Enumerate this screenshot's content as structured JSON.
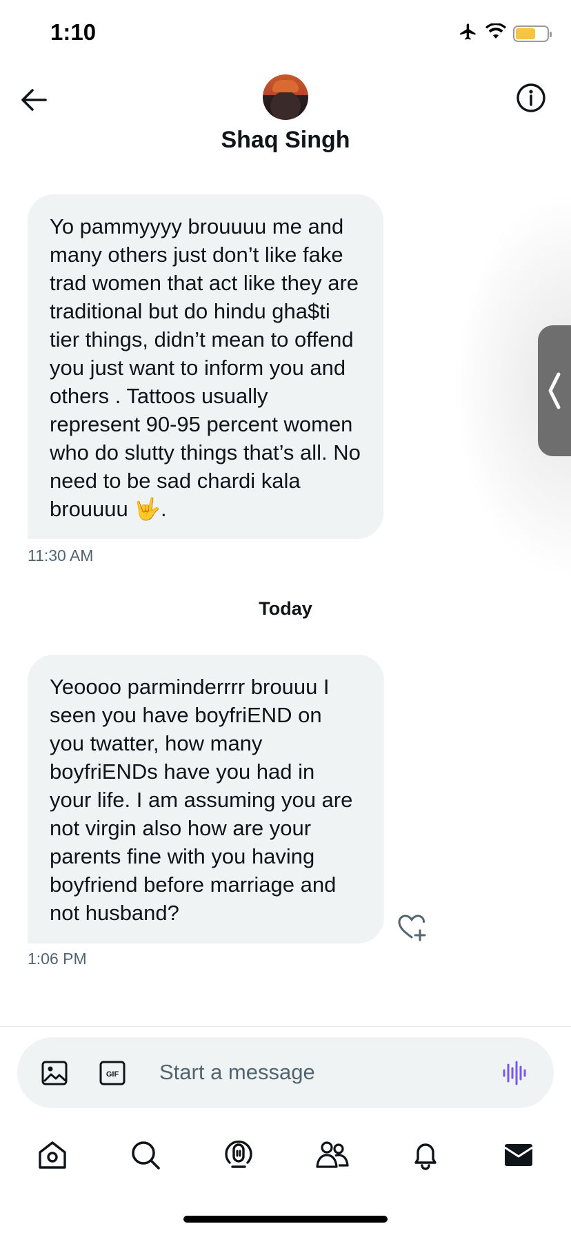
{
  "status_bar": {
    "time": "1:10"
  },
  "header": {
    "title": "Shaq Singh",
    "back_icon": "arrow-left-icon",
    "info_icon": "info-icon"
  },
  "messages": [
    {
      "text": "Yo pammyyyy brouuuu me and many others just don’t like fake trad women that act like they are traditional but do hindu gha$ti tier things, didn’t mean to offend you just want to inform you and others . Tattoos usually represent 90-95 percent women who do slutty things that’s all. No need to be sad chardi kala brouuuu 🤟.",
      "time": "11:30 AM"
    },
    {
      "text": "Yeoooo parminderrrr brouuu I seen you have boyfriEND on you twatter, how many boyfriENDs have you had in your life. I am assuming you are not virgin also how are your parents fine with you having boyfriend before marriage and not husband?",
      "time": "1:06 PM"
    }
  ],
  "day_separator": "Today",
  "composer": {
    "placeholder": "Start a message",
    "value": ""
  },
  "nav": [
    "home-icon",
    "search-icon",
    "spaces-icon",
    "communities-icon",
    "notifications-icon",
    "messages-icon"
  ],
  "colors": {
    "bubble_bg": "#eff3f4",
    "accent": "#7856ff",
    "battery": "#f5c542",
    "text": "#0f1419",
    "muted": "#536471"
  }
}
